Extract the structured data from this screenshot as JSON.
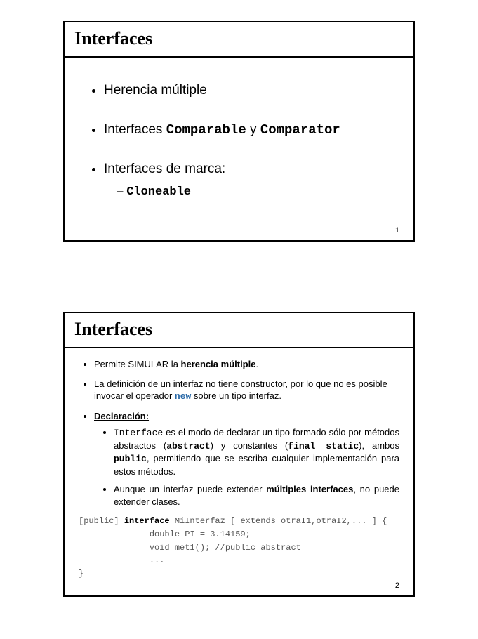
{
  "slide1": {
    "title": "Interfaces",
    "items": {
      "b1": "Herencia múltiple",
      "b2_pre": "Interfaces ",
      "b2_c1": "Comparable",
      "b2_mid": " y ",
      "b2_c2": "Comparator",
      "b3": "Interfaces de marca:",
      "b3_sub": "Cloneable"
    },
    "page": "1"
  },
  "slide2": {
    "title": "Interfaces",
    "b1_pre": "Permite SIMULAR la ",
    "b1_bold": "herencia múltiple",
    "b1_post": ".",
    "b2_pre": "La definición de un interfaz no tiene constructor, por lo que no es posible invocar el operador ",
    "b2_new": "new",
    "b2_post": " sobre un tipo interfaz.",
    "b3_head": "Declaración:",
    "b3s1_p1": "Interface",
    "b3s1_p2": " es el modo de declarar un tipo formado sólo por métodos abstractos (",
    "b3s1_abs": "abstract",
    "b3s1_p3": ") y constantes (",
    "b3s1_fs": "final static",
    "b3s1_p4": "), ambos ",
    "b3s1_pub": "public",
    "b3s1_p5": ", permitiendo que se escriba cualquier implementación para estos métodos.",
    "b3s2_p1": "Aunque un interfaz puede extender ",
    "b3s2_bold": "múltiples interfaces",
    "b3s2_p2": ", no puede extender clases.",
    "code": {
      "l1_open": "[public] ",
      "l1_kw": "interface",
      "l1_rest": " MiInterfaz [ extends otraI1,otraI2,... ] {",
      "l2": "              double PI = 3.14159;",
      "l3": "              void met1(); //public abstract",
      "l4": "              ...",
      "l5": "}"
    },
    "page": "2"
  }
}
